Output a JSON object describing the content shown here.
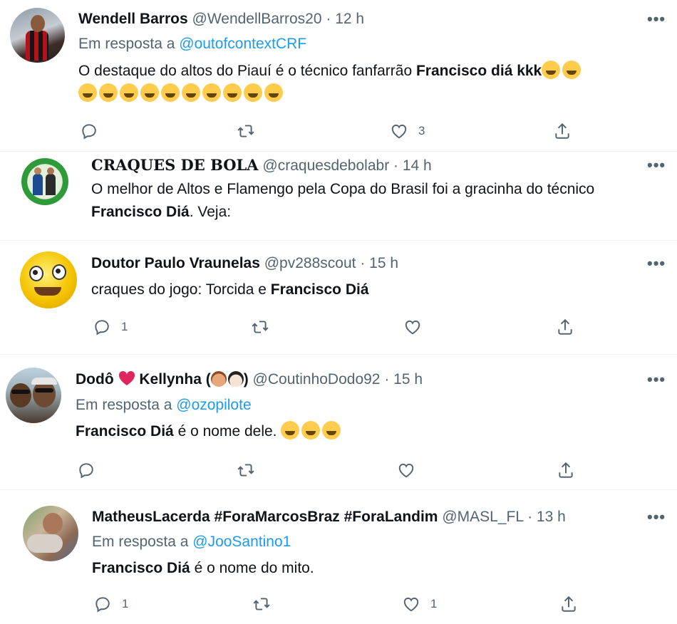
{
  "tweets": [
    {
      "name": "Wendell Barros",
      "handle": "@WendellBarros20",
      "time": "· 12 h",
      "reply_prefix": "Em resposta a",
      "reply_to": "@outofcontextCRF",
      "text_plain": "O destaque do altos do Piauí é o técnico fanfarrão ",
      "text_bold": "Francisco diá kkk",
      "reply_count": "",
      "like_count": "3"
    },
    {
      "name": "CRAQUES DE BOLA",
      "handle": "@craquesdebolabr",
      "time": "· 14 h",
      "text_plain": "O melhor de Altos e Flamengo pela Copa do Brasil foi a gracinha do técnico",
      "text_bold": "Francisco Diá",
      "text_after": ". Veja:",
      "avatar_label": "CRAQUES DE BOLA"
    },
    {
      "name": "Doutor Paulo Vraunelas",
      "handle": "@pv288scout",
      "time": "· 15 h",
      "text_plain": "craques do jogo: Torcida e ",
      "text_bold": "Francisco Diá",
      "reply_count": "1",
      "like_count": ""
    },
    {
      "name_part1": "Dodô",
      "name_part2": "Kellynha (",
      "name_part3": ")",
      "handle": "@CoutinhoDodo92",
      "time": "· 15 h",
      "reply_prefix": "Em resposta a",
      "reply_to": "@ozopilote",
      "text_bold": "Francisco Diá",
      "text_plain": " é o nome dele. ",
      "reply_count": "",
      "like_count": ""
    },
    {
      "name": "MatheusLacerda #ForaMarcosBraz #ForaLandim",
      "handle": "@MASL_FL",
      "time": "· 13 h",
      "reply_prefix": "Em resposta a",
      "reply_to": "@JooSantino1",
      "text_bold": "Francisco Diá",
      "text_plain": " é o nome do mito.",
      "reply_count": "1",
      "like_count": "1"
    }
  ],
  "icons": {
    "reply": "reply-icon",
    "retweet": "retweet-icon",
    "like": "heart-icon",
    "share": "share-icon",
    "more": "more-icon"
  },
  "more_label": "•••",
  "colors": {
    "text": "#0f1419",
    "secondary": "#536471",
    "link": "#1d9bf0",
    "divider": "#eff3f4",
    "heart_red": "#e0245e"
  }
}
